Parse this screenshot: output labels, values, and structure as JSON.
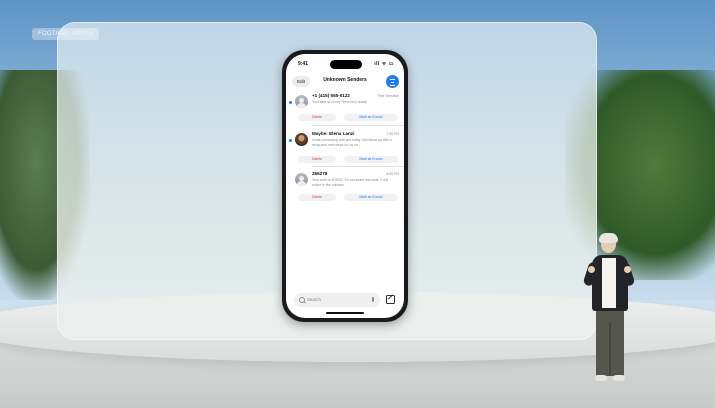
{
  "footage_label": "FOOTAGE: APPLE",
  "phone": {
    "status_time": "9:41",
    "status_icons": "ıll ᯤ ▭",
    "nav": {
      "edit_label": "Edit",
      "title": "Unknown Senders"
    },
    "messages": [
      {
        "sender": "+1 (415) 555-0122",
        "time": "Time Sensitive",
        "preview": "Your latte at Cuzzy Stevens is ready!",
        "delete_label": "Delete",
        "mark_known_label": "Mark as Known",
        "unread": true
      },
      {
        "sender": "Maybe: Elena Lanzi",
        "time": "7:06 PM",
        "preview": "Great connecting with you today. Will follow up with a recap and next steps for us on...",
        "delete_label": "Delete",
        "mark_known_label": "Mark as Known",
        "unread": true
      },
      {
        "sender": "266278",
        "time": "6:09 PM",
        "preview": "Your code is 403002. Do not share this code. It will expire in five minutes.",
        "delete_label": "Delete",
        "mark_known_label": "Mark as Known",
        "unread": false
      }
    ],
    "search": {
      "placeholder": "Search"
    }
  },
  "colors": {
    "accent": "#1f7cf2",
    "destructive": "#e0302c"
  },
  "icons": [
    "search-icon",
    "microphone-icon",
    "compose-icon",
    "filter-icon",
    "contact-avatar-icon"
  ]
}
